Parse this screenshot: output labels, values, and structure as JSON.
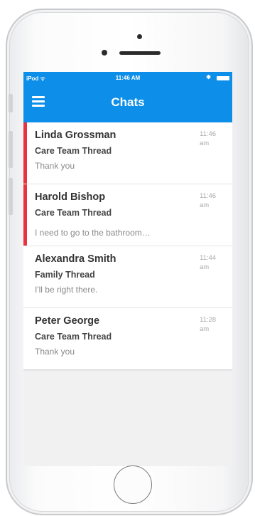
{
  "status_bar": {
    "carrier": "iPod ᯤ",
    "time": "11:46 AM",
    "bluetooth": "✱"
  },
  "nav": {
    "title": "Chats"
  },
  "chats": [
    {
      "name": "Linda Grossman",
      "thread": "Care Team Thread",
      "preview": "Thank you",
      "time": "11:46",
      "ampm": "am",
      "unread": true
    },
    {
      "name": "Harold Bishop",
      "thread": "Care Team Thread",
      "preview": "I need to go to the bathroom…",
      "time": "11:46",
      "ampm": "am",
      "unread": true
    },
    {
      "name": "Alexandra Smith",
      "thread": "Family Thread",
      "preview": "I'll be right there.",
      "time": "11:44",
      "ampm": "am",
      "unread": false
    },
    {
      "name": "Peter George",
      "thread": "Care Team Thread",
      "preview": "Thank you",
      "time": "11:28",
      "ampm": "am",
      "unread": false
    }
  ],
  "colors": {
    "brand": "#0d8ee8",
    "unread_indicator": "#e8343f"
  }
}
